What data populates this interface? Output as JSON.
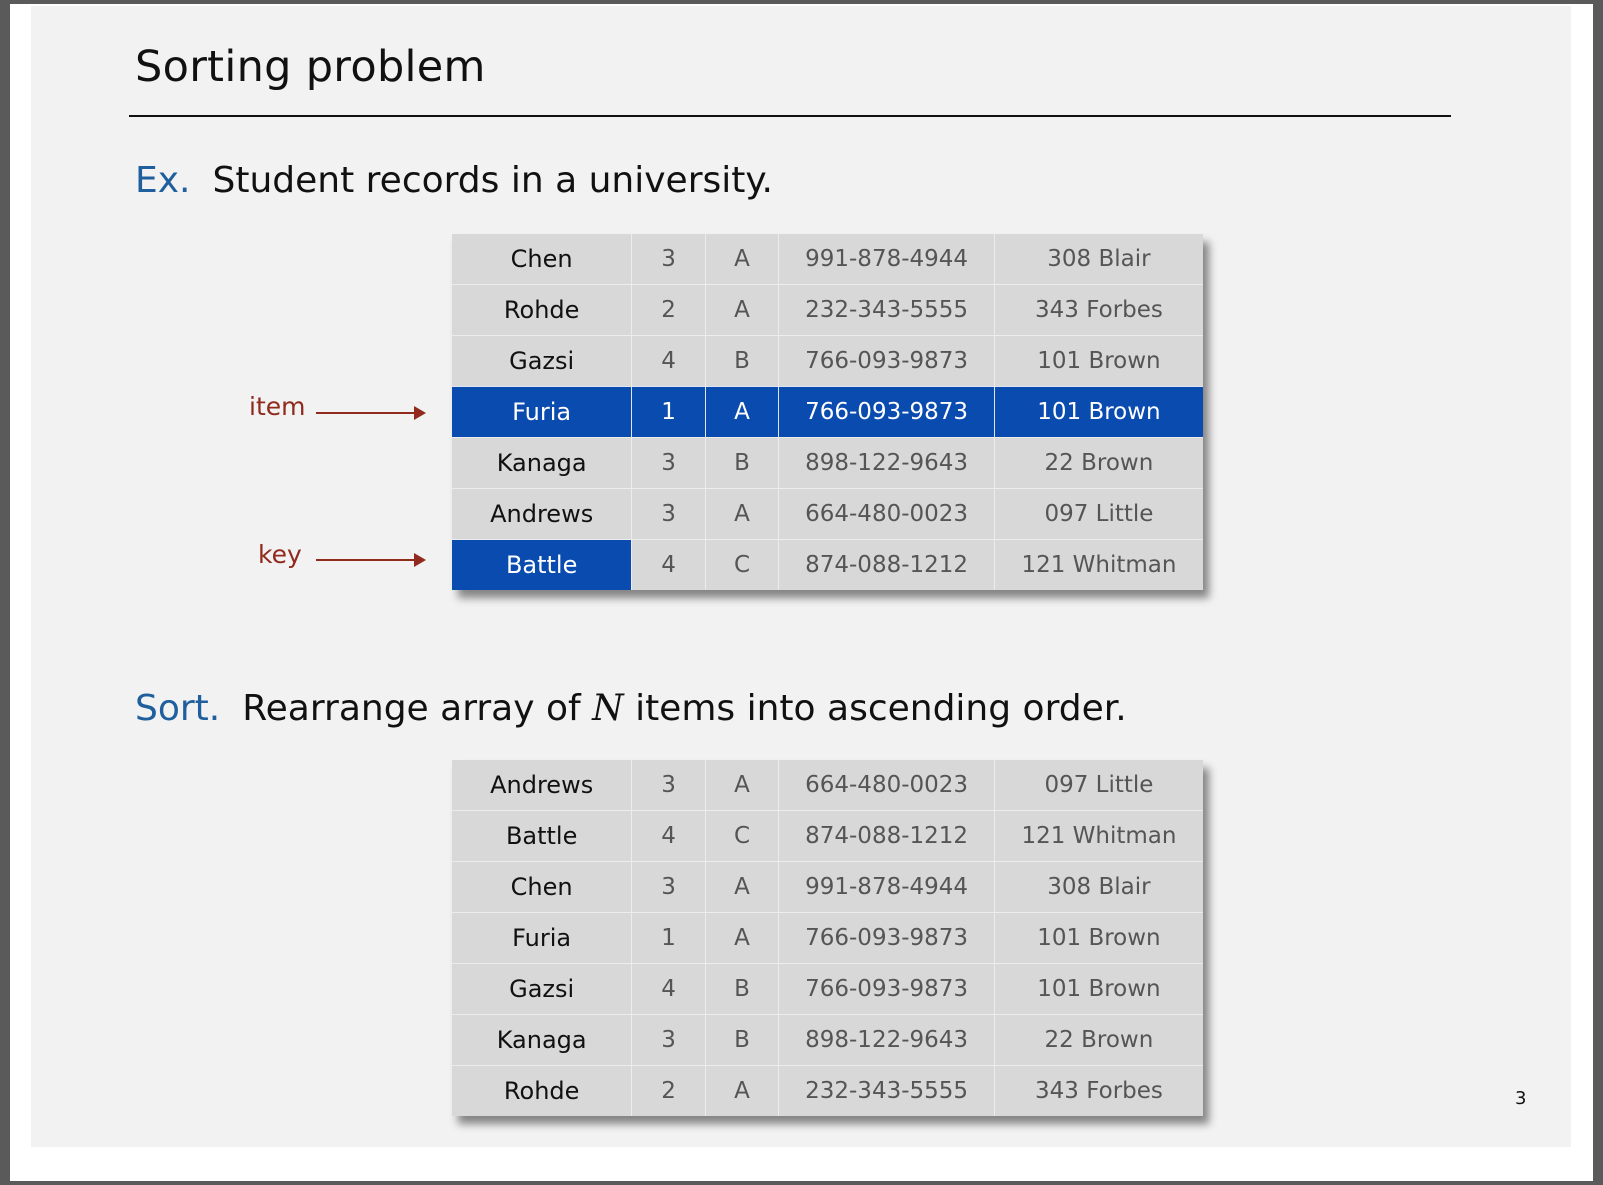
{
  "title": "Sorting problem",
  "example": {
    "tag": "Ex.",
    "text": "Student records in a university."
  },
  "sort": {
    "tag": "Sort.",
    "text_before": "Rearrange array of ",
    "variable": "N",
    "text_after": " items into ascending order."
  },
  "callouts": {
    "item": "item",
    "key": "key"
  },
  "colors": {
    "highlight": "#0a4bb0",
    "callout": "#8f2a1c",
    "tag": "#1f5f9e"
  },
  "records_unsorted": [
    [
      "Chen",
      "3",
      "A",
      "991-878-4944",
      "308 Blair"
    ],
    [
      "Rohde",
      "2",
      "A",
      "232-343-5555",
      "343 Forbes"
    ],
    [
      "Gazsi",
      "4",
      "B",
      "766-093-9873",
      "101 Brown"
    ],
    [
      "Furia",
      "1",
      "A",
      "766-093-9873",
      "101 Brown"
    ],
    [
      "Kanaga",
      "3",
      "B",
      "898-122-9643",
      "22 Brown"
    ],
    [
      "Andrews",
      "3",
      "A",
      "664-480-0023",
      "097 Little"
    ],
    [
      "Battle",
      "4",
      "C",
      "874-088-1212",
      "121 Whitman"
    ]
  ],
  "highlighted_item_row": 3,
  "highlighted_key_row": 6,
  "records_sorted": [
    [
      "Andrews",
      "3",
      "A",
      "664-480-0023",
      "097 Little"
    ],
    [
      "Battle",
      "4",
      "C",
      "874-088-1212",
      "121 Whitman"
    ],
    [
      "Chen",
      "3",
      "A",
      "991-878-4944",
      "308 Blair"
    ],
    [
      "Furia",
      "1",
      "A",
      "766-093-9873",
      "101 Brown"
    ],
    [
      "Gazsi",
      "4",
      "B",
      "766-093-9873",
      "101 Brown"
    ],
    [
      "Kanaga",
      "3",
      "B",
      "898-122-9643",
      "22 Brown"
    ],
    [
      "Rohde",
      "2",
      "A",
      "232-343-5555",
      "343 Forbes"
    ]
  ],
  "page_number": "3"
}
